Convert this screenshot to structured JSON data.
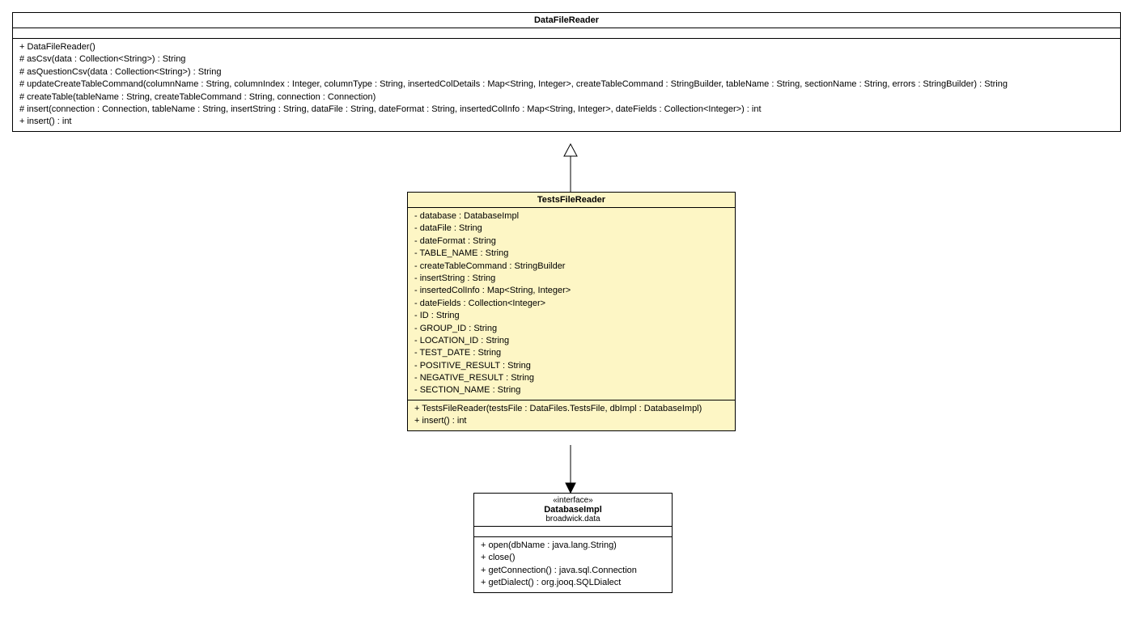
{
  "classes": {
    "datafilereader": {
      "name": "DataFileReader",
      "methods": [
        "+ DataFileReader()",
        "# asCsv(data : Collection<String>) : String",
        "# asQuestionCsv(data : Collection<String>) : String",
        "# updateCreateTableCommand(columnName : String, columnIndex : Integer, columnType : String, insertedColDetails : Map<String, Integer>, createTableCommand : StringBuilder, tableName : String, sectionName : String, errors : StringBuilder) : String",
        "# createTable(tableName : String, createTableCommand : String, connection : Connection)",
        "# insert(connection : Connection, tableName : String, insertString : String, dataFile : String, dateFormat : String, insertedColInfo : Map<String, Integer>, dateFields : Collection<Integer>) : int",
        "+ insert() : int"
      ]
    },
    "testsfilereader": {
      "name": "TestsFileReader",
      "attributes": [
        "- database : DatabaseImpl",
        "- dataFile : String",
        "- dateFormat : String",
        "- TABLE_NAME : String",
        "- createTableCommand : StringBuilder",
        "- insertString : String",
        "- insertedColInfo : Map<String, Integer>",
        "- dateFields : Collection<Integer>",
        "- ID : String",
        "- GROUP_ID : String",
        "- LOCATION_ID : String",
        "- TEST_DATE : String",
        "- POSITIVE_RESULT : String",
        "- NEGATIVE_RESULT : String",
        "- SECTION_NAME : String"
      ],
      "methods": [
        "+ TestsFileReader(testsFile : DataFiles.TestsFile, dbImpl : DatabaseImpl)",
        "+ insert() : int"
      ]
    },
    "databaseimpl": {
      "stereotype": "«interface»",
      "name": "DatabaseImpl",
      "package": "broadwick.data",
      "methods": [
        "+ open(dbName : java.lang.String)",
        "+ close()",
        "+ getConnection() : java.sql.Connection",
        "+ getDialect() : org.jooq.SQLDialect"
      ]
    }
  }
}
